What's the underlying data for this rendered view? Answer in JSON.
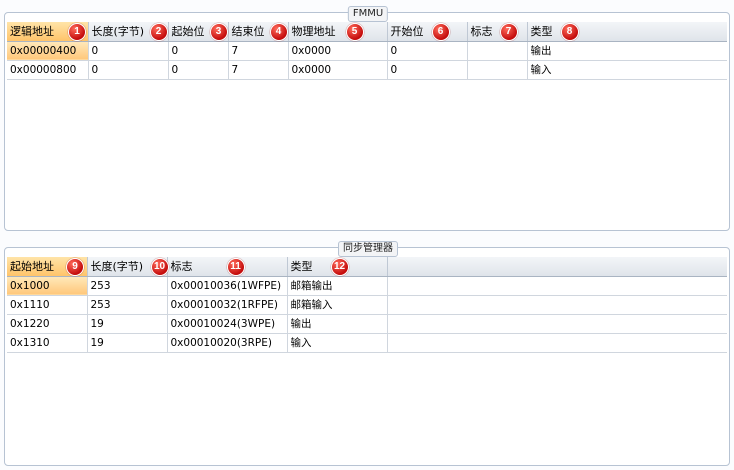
{
  "fmmu": {
    "title": "FMMU",
    "columns": [
      {
        "label": "逻辑地址",
        "badge": "1"
      },
      {
        "label": "长度(字节)",
        "badge": "2"
      },
      {
        "label": "起始位",
        "badge": "3"
      },
      {
        "label": "结束位",
        "badge": "4"
      },
      {
        "label": "物理地址",
        "badge": "5"
      },
      {
        "label": "开始位",
        "badge": "6"
      },
      {
        "label": "标志",
        "badge": "7"
      },
      {
        "label": "类型",
        "badge": "8"
      }
    ],
    "rows": [
      [
        "0x00000400",
        "0",
        "0",
        "7",
        "0x0000",
        "0",
        "",
        "输出"
      ],
      [
        "0x00000800",
        "0",
        "0",
        "7",
        "0x0000",
        "0",
        "",
        "输入"
      ]
    ]
  },
  "sync_manager": {
    "title": "同步管理器",
    "columns": [
      {
        "label": "起始地址",
        "badge": "9"
      },
      {
        "label": "长度(字节)",
        "badge": "10"
      },
      {
        "label": "标志",
        "badge": "11"
      },
      {
        "label": "类型",
        "badge": "12"
      }
    ],
    "rows": [
      [
        "0x1000",
        "253",
        "0x00010036(1WFPE)",
        "邮箱输出"
      ],
      [
        "0x1110",
        "253",
        "0x00010032(1RFPE)",
        "邮箱输入"
      ],
      [
        "0x1220",
        "19",
        "0x00010024(3WPE)",
        "输出"
      ],
      [
        "0x1310",
        "19",
        "0x00010020(3RPE)",
        "输入"
      ]
    ]
  },
  "colors": {
    "selected_cell": "#ffc46a",
    "badge": "#d8140f",
    "group_border": "#b7c3d3"
  }
}
